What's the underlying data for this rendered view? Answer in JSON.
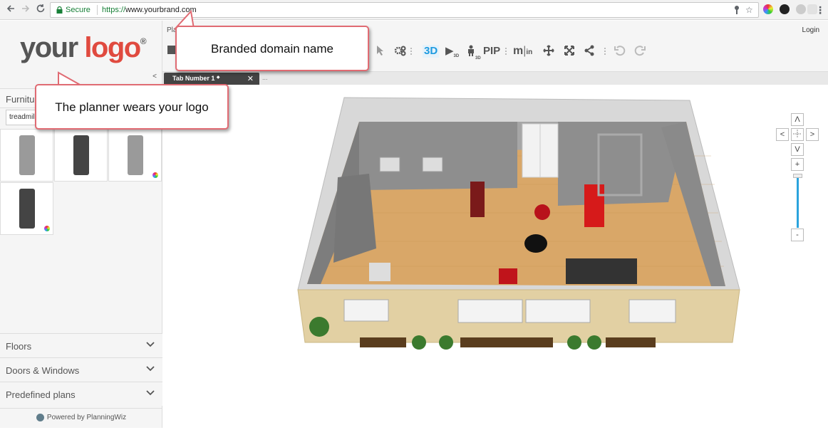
{
  "browser": {
    "secure_label": "Secure",
    "url_protocol": "https://",
    "url_host": "www.yourbrand.com",
    "back_icon": "arrow-left-icon",
    "forward_icon": "arrow-right-icon",
    "reload_icon": "reload-icon"
  },
  "logo": {
    "your": "your",
    "logo": "logo",
    "reg": "®"
  },
  "sidebar": {
    "section_title": "Furnitu",
    "search_value": "treadmil",
    "accordions": [
      "Floors",
      "Doors & Windows",
      "Predefined plans"
    ],
    "powered_by": "Powered by PlanningWiz"
  },
  "topbar": {
    "plan_label": "Pla",
    "login": "Login",
    "btn_3d": "3D",
    "btn_pip": "PIP",
    "btn_m": "m",
    "btn_in": "in",
    "btn_play_sub": "3D",
    "btn_person_sub": "3D"
  },
  "tabs": {
    "active": "Tab Number 1",
    "modified_mark": "◆",
    "more": "...",
    "prev": "<",
    "close": "✕"
  },
  "nav": {
    "up": "Λ",
    "left": "<",
    "right": ">",
    "down": "V",
    "zoom_in": "+",
    "zoom_out": "-"
  },
  "callouts": {
    "domain": "Branded domain name",
    "logo": "The planner wears your logo"
  },
  "colors": {
    "accent": "#1e9be0",
    "logo_red": "#e04a3f",
    "callout_border": "#e06b73",
    "secure_green": "#188038"
  }
}
